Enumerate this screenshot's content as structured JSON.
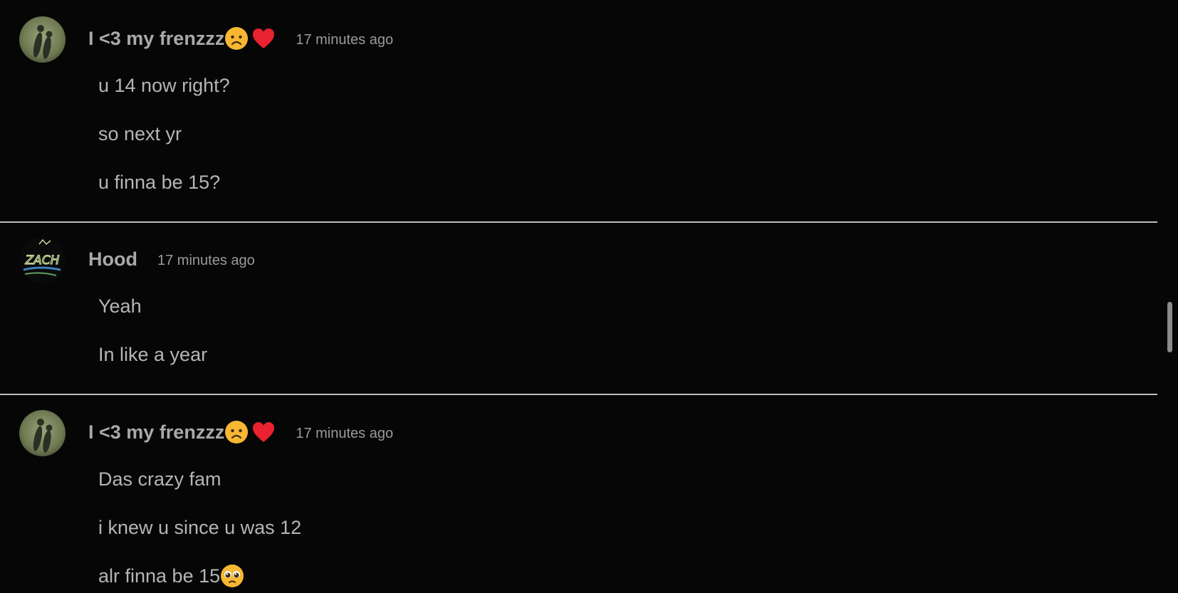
{
  "messages": [
    {
      "username": "I <3 my frenzzz",
      "username_emojis": [
        "frowning-face-emoji",
        "red-heart-emoji"
      ],
      "timestamp": "17 minutes ago",
      "lines": [
        "u 14 now right?",
        "so next yr",
        "u finna be 15?"
      ]
    },
    {
      "username": "Hood",
      "username_emojis": [],
      "timestamp": "17 minutes ago",
      "avatar_text": "ZACH",
      "lines": [
        "Yeah",
        "In like a year"
      ]
    },
    {
      "username": "I <3 my frenzzz",
      "username_emojis": [
        "frowning-face-emoji",
        "red-heart-emoji"
      ],
      "timestamp": "17 minutes ago",
      "lines": [
        "Das crazy fam",
        "i knew u since u was 12",
        "alr finna be 15"
      ],
      "last_line_emoji": "pleading-face-emoji"
    }
  ],
  "colors": {
    "background": "#060606",
    "divider": "#bdbdbd",
    "text": "#b5b5b5"
  }
}
